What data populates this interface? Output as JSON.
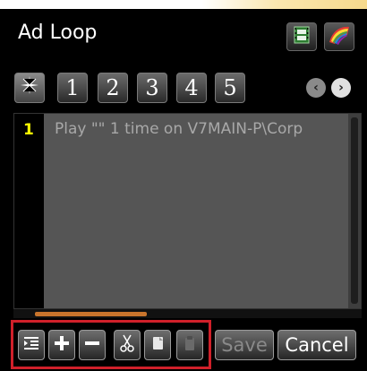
{
  "window": {
    "title": "Ad Loop"
  },
  "title_buttons": [
    {
      "icon": "film-icon"
    },
    {
      "icon": "color-palette-icon"
    }
  ],
  "pages": {
    "star_icon": "sparkle-icon",
    "numbers": [
      "1",
      "2",
      "3",
      "4",
      "5"
    ],
    "prev_glyph": "‹",
    "next_glyph": "›"
  },
  "list": {
    "items": [
      {
        "index": "1",
        "text": "Play \"\" 1 time on V7MAIN-P\\Corp"
      }
    ]
  },
  "toolbar": {
    "tools": [
      {
        "icon": "indent-icon"
      },
      {
        "icon": "plus-icon"
      },
      {
        "icon": "minus-icon"
      },
      {
        "icon": "scissors-icon"
      },
      {
        "icon": "copy-icon"
      },
      {
        "icon": "paste-icon"
      }
    ],
    "save_label": "Save",
    "cancel_label": "Cancel"
  },
  "colors": {
    "highlight_border": "#d0202a",
    "line_number": "#ffff00",
    "scroll_thumb": "#c8742c"
  }
}
